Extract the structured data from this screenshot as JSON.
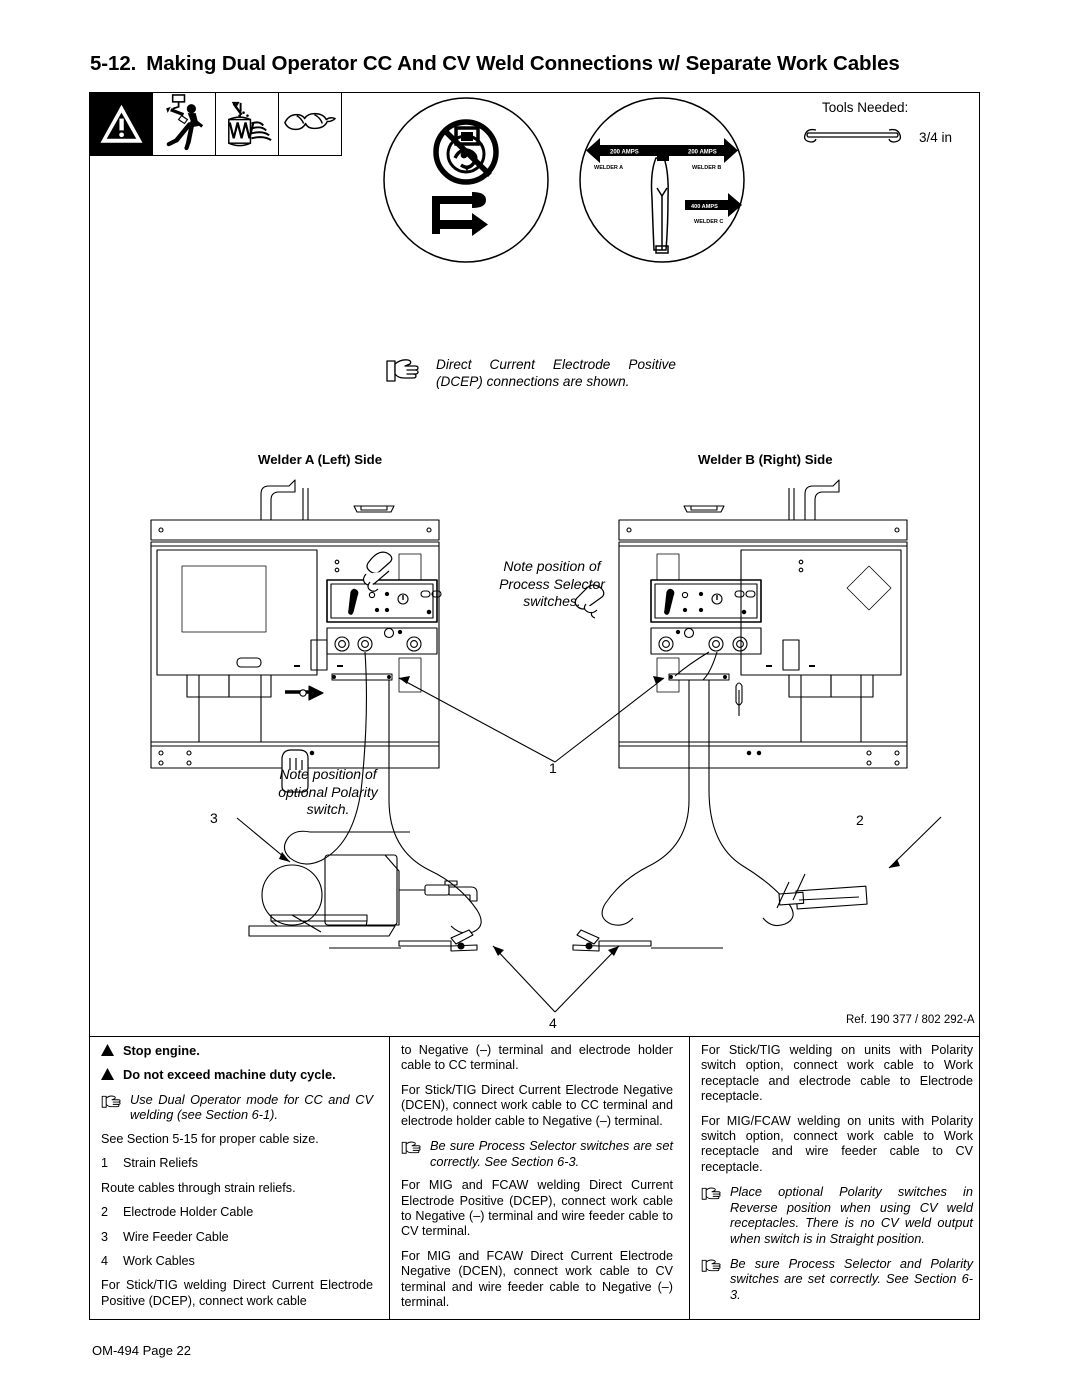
{
  "document": {
    "section_number": "5-12.",
    "title": "Making Dual Operator CC And CV Weld Connections w/ Separate Work Cables",
    "footer": "OM-494 Page 22",
    "reference": "Ref. 190 377 / 802 292-A"
  },
  "safety_icons": [
    {
      "name": "warning-triangle-icon",
      "label": "Warning"
    },
    {
      "name": "electric-shock-icon",
      "label": "Electric shock hazard"
    },
    {
      "name": "exploding-battery-icon",
      "label": "Battery explosion hazard"
    },
    {
      "name": "safety-goggles-icon",
      "label": "Wear safety goggles"
    }
  ],
  "pictograms": [
    {
      "name": "stop-engine-pictogram",
      "label": "Stop engine before servicing"
    },
    {
      "name": "dual-operator-amperage-pictogram",
      "label": "Dual operator amperage split",
      "arrow_labels": [
        "200 AMPS",
        "200 AMPS",
        "400 AMPS"
      ],
      "welder_labels": [
        "WELDER A",
        "WELDER B",
        "WELDER C"
      ]
    }
  ],
  "tools": {
    "label": "Tools Needed:",
    "wrench_size": "3/4 in",
    "icon": "open-end-wrench-icon"
  },
  "notes": {
    "dcep": "Direct Current Electrode Positive (DCEP) connections are shown.",
    "process_selector": "Note position of Process Selector switches.",
    "polarity_switch": "Note position of  optional Polarity switch."
  },
  "diagram": {
    "welder_a_label": "Welder A (Left) Side",
    "welder_b_label": "Welder B (Right) Side",
    "callouts": [
      "1",
      "2",
      "3",
      "4"
    ]
  },
  "columns": {
    "left": {
      "warnings": [
        {
          "icon": "warning-triangle-icon",
          "text": "Stop engine."
        },
        {
          "icon": "warning-triangle-icon",
          "text": "Do not exceed machine duty cycle."
        }
      ],
      "hand_note": "Use Dual Operator mode for CC and CV welding (see Section 6-1).",
      "cable_size_note": "See Section 5-15 for proper cable size.",
      "items": [
        {
          "num": "1",
          "text": "Strain Reliefs"
        },
        {
          "num": "2",
          "text": "Electrode Holder Cable"
        },
        {
          "num": "3",
          "text": "Wire Feeder Cable"
        },
        {
          "num": "4",
          "text": "Work Cables"
        }
      ],
      "route_note": "Route cables through strain reliefs.",
      "tail_paragraph": "For Stick/TIG welding Direct Current Electrode Positive (DCEP), connect work cable"
    },
    "mid": {
      "p1": "to Negative (–) terminal and electrode holder cable to CC terminal.",
      "p2": "For Stick/TIG Direct Current Electrode Negative (DCEN), connect work cable to CC terminal and electrode holder cable to Negative (–) terminal.",
      "hand_note": "Be sure Process Selector switches are set correctly. See Section 6-3.",
      "p3": "For MIG and FCAW welding Direct Current Electrode Positive (DCEP), connect work cable to Negative (–) terminal and wire feeder cable to CV terminal.",
      "p4": "For MIG and FCAW Direct Current Electrode Negative (DCEN), connect work cable to CV terminal and wire feeder cable to Negative (–) terminal."
    },
    "right": {
      "p1": "For Stick/TIG welding on units with Polarity switch option, connect work cable to Work receptacle and electrode cable to Electrode receptacle.",
      "p2": "For MIG/FCAW welding on units with Polarity switch option, connect work cable to Work receptacle and wire feeder cable to CV receptacle.",
      "hand_note_1": "Place optional Polarity switches in Reverse position when using CV weld receptacles. There is no CV weld output when switch is in Straight position.",
      "hand_note_2": "Be sure Process Selector and Polarity switches are set correctly. See Section 6-3."
    }
  }
}
